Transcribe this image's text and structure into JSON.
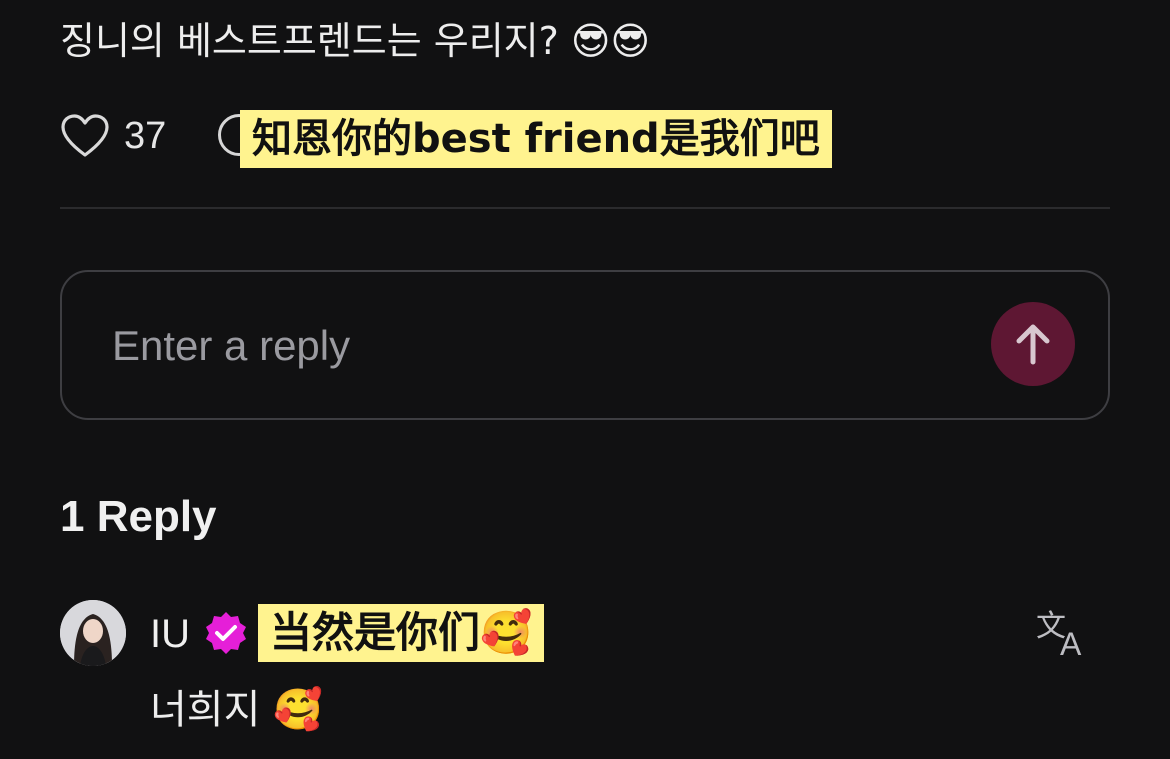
{
  "comment": {
    "text": "징니의 베스트프렌드는 우리지? 😎😎"
  },
  "actions": {
    "like_icon": "heart-outline-icon",
    "like_count": "37",
    "reply_icon": "comment-bubble-icon",
    "translation_overlay": "知恩你的best friend是我们吧"
  },
  "reply_box": {
    "placeholder": "Enter a reply",
    "send_icon": "arrow-up-icon"
  },
  "replies": {
    "count_label": "1 Reply",
    "items": [
      {
        "username": "IU",
        "verified_icon": "verified-badge-icon",
        "translation_overlay": "当然是你们🥰",
        "text": "너희지 🥰",
        "translate_icon": "translate-icon"
      }
    ]
  },
  "colors": {
    "background": "#111112",
    "highlight": "#fff38f",
    "send_button": "#5e1733",
    "verified": "#e51fd8"
  }
}
